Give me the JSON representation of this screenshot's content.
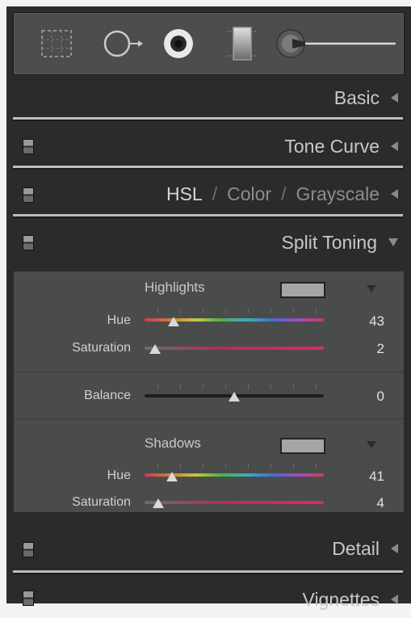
{
  "toolbar": {
    "tools": [
      "crop-overlay-icon",
      "spot-removal-icon",
      "red-eye-icon",
      "graduated-filter-icon",
      "adjustment-brush-icon"
    ]
  },
  "sections": {
    "basic": "Basic",
    "tone_curve": "Tone Curve",
    "hsl": "HSL",
    "color": "Color",
    "grayscale": "Grayscale",
    "slash": "/",
    "split_toning": "Split Toning",
    "detail": "Detail",
    "vignettes": "Vignettes"
  },
  "split_toning": {
    "highlights": {
      "title": "Highlights",
      "hue_label": "Hue",
      "hue_value": "43",
      "sat_label": "Saturation",
      "sat_value": "2"
    },
    "balance": {
      "label": "Balance",
      "value": "0"
    },
    "shadows": {
      "title": "Shadows",
      "hue_label": "Hue",
      "hue_value": "41",
      "sat_label": "Saturation",
      "sat_value": "4"
    },
    "swatch_color": "#a5a5a5"
  }
}
